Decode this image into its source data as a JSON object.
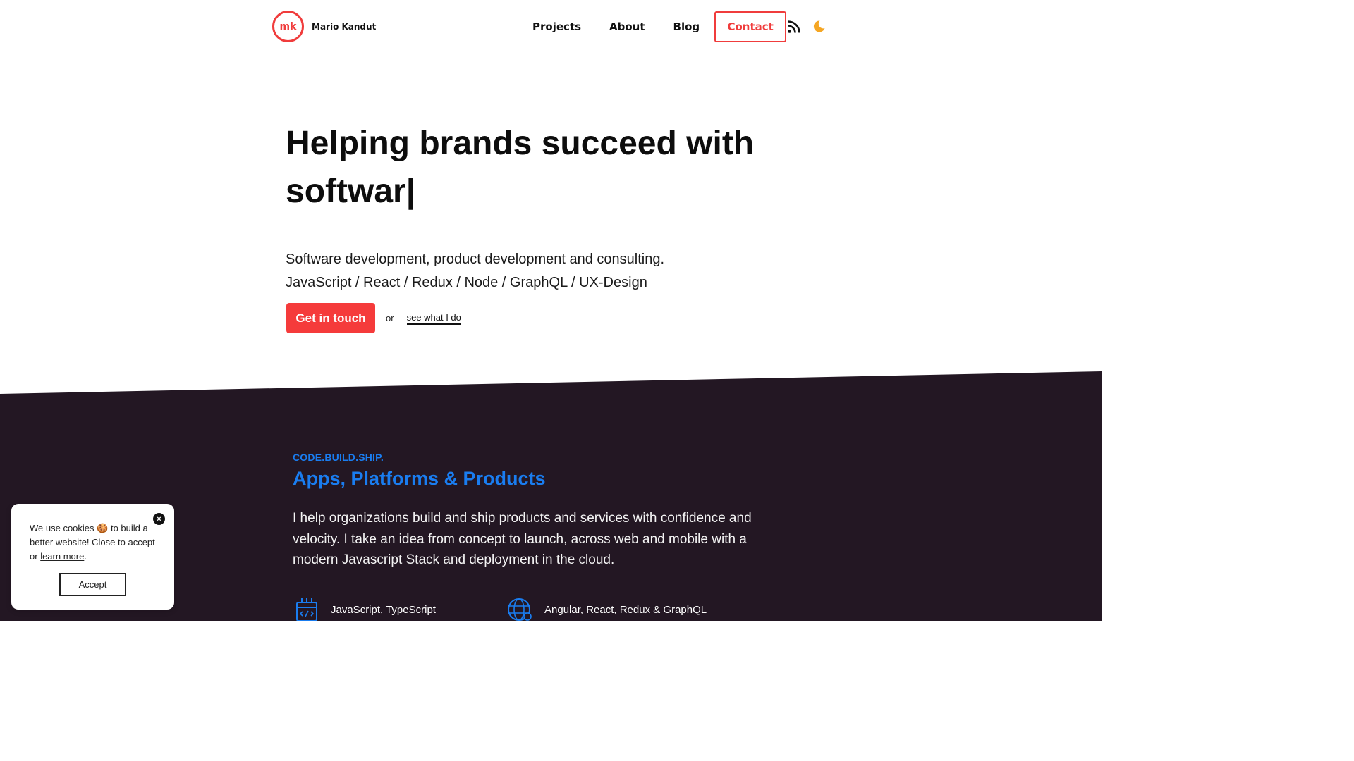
{
  "header": {
    "logo_mark": "mk",
    "brand_name": "Mario Kandut",
    "nav": {
      "projects": "Projects",
      "about": "About",
      "blog": "Blog",
      "contact": "Contact"
    },
    "icons": {
      "rss": "rss-icon",
      "theme": "moon-icon"
    }
  },
  "hero": {
    "title": "Helping brands succeed with softwar|",
    "subtitle_line1": "Software development, product development and consulting.",
    "subtitle_line2": "JavaScript / React / Redux / Node / GraphQL / UX-Design",
    "cta_label": "Get in touch",
    "or_text": "or",
    "secondary_link": "see what I do"
  },
  "section": {
    "kicker": "CODE.BUILD.SHIP.",
    "title": "Apps, Platforms & Products",
    "text": "I help organizations build and ship products and services with confidence and velocity. I take an idea from concept to launch, across web and mobile with a modern Javascript Stack and deployment in the cloud.",
    "features": [
      {
        "label": "JavaScript, TypeScript",
        "icon": "code-window-icon"
      },
      {
        "label": "Angular, React, Redux & GraphQL",
        "icon": "globe-code-icon"
      }
    ]
  },
  "cookie": {
    "text_part1": "We use cookies",
    "cookie_emoji": "🍪",
    "text_part2": "to build a better website! Close to accept or",
    "learn_more": "learn more",
    "period": ".",
    "accept": "Accept",
    "close": "×"
  },
  "colors": {
    "accent_red": "#f03c3c",
    "accent_blue": "#1a7df0",
    "dark_bg": "#231723",
    "moon": "#f5a623"
  }
}
